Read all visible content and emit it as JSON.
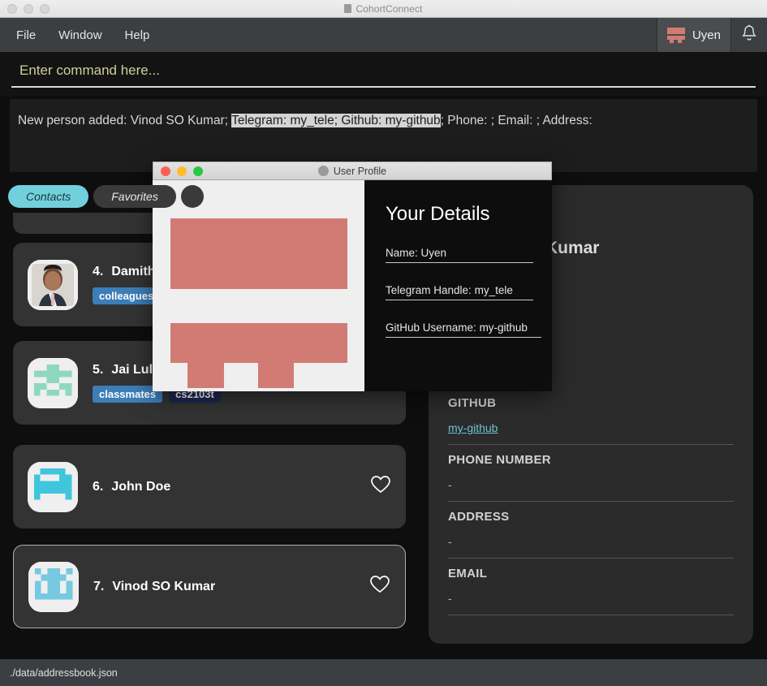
{
  "window": {
    "title": "CohortConnect",
    "traffic_lights": [
      "close",
      "minimize",
      "zoom"
    ],
    "doc_icon": "document-icon"
  },
  "menubar": {
    "items": [
      {
        "label": "File",
        "name": "menu-file"
      },
      {
        "label": "Window",
        "name": "menu-window"
      },
      {
        "label": "Help",
        "name": "menu-help"
      }
    ],
    "user": {
      "label": "Uyen",
      "icon": "broken-image-icon"
    },
    "notification_icon": "bell-icon"
  },
  "command": {
    "placeholder": "Enter command here...",
    "value": ""
  },
  "result": {
    "prefix": "New person added: Vinod SO Kumar; ",
    "selected": "Telegram: my_tele; Github: my-github",
    "suffix": "; Phone: ; Email: ; Address:"
  },
  "tabs": [
    {
      "label": "Contacts",
      "active": true
    },
    {
      "label": "Favorites",
      "active": false
    },
    {
      "label": "",
      "active": false
    }
  ],
  "contacts": [
    {
      "index": "4.",
      "name": "Damith",
      "tags": [
        {
          "label": "colleagues",
          "color": "#3c7eb8"
        }
      ],
      "avatar": "photo-avatar",
      "favorite": false,
      "selected": false
    },
    {
      "index": "5.",
      "name": "Jai Lulla",
      "tags": [
        {
          "label": "classmates",
          "color": "#3c7eb8"
        },
        {
          "label": "cs2103t",
          "color": "#1c2750"
        }
      ],
      "avatar": "identicon-green",
      "favorite": false,
      "selected": false
    },
    {
      "index": "6.",
      "name": "John Doe",
      "tags": [],
      "avatar": "identicon-cyan",
      "favorite": false,
      "selected": false
    },
    {
      "index": "7.",
      "name": "Vinod SO Kumar",
      "tags": [],
      "avatar": "identicon-blue",
      "favorite": false,
      "selected": true
    }
  ],
  "detail": {
    "name": "Vinod SO Kumar",
    "fields": [
      {
        "label": "GITHUB",
        "value": "my-github",
        "is_link": true
      },
      {
        "label": "PHONE NUMBER",
        "value": "-",
        "is_link": false
      },
      {
        "label": "ADDRESS",
        "value": "-",
        "is_link": false
      },
      {
        "label": "EMAIL",
        "value": "-",
        "is_link": false
      }
    ]
  },
  "status": {
    "file_path": "./data/addressbook.json"
  },
  "dialog": {
    "title": "User Profile",
    "title_icon": "person-icon",
    "heading": "Your Details",
    "image": "broken-image-placeholder",
    "fields": [
      {
        "label": "Name:",
        "value": "Uyen"
      },
      {
        "label": "Telegram Handle:",
        "value": "my_tele"
      },
      {
        "label": "GitHub Username:",
        "value": "my-github"
      }
    ]
  },
  "colors": {
    "accent_teal": "#72d0dd",
    "link_teal": "#6fc3d4",
    "tag_blue": "#3c7eb8",
    "tag_navy": "#1c2750",
    "salmon": "#d27b74",
    "panel": "#2b2b2b",
    "card": "#333333"
  }
}
